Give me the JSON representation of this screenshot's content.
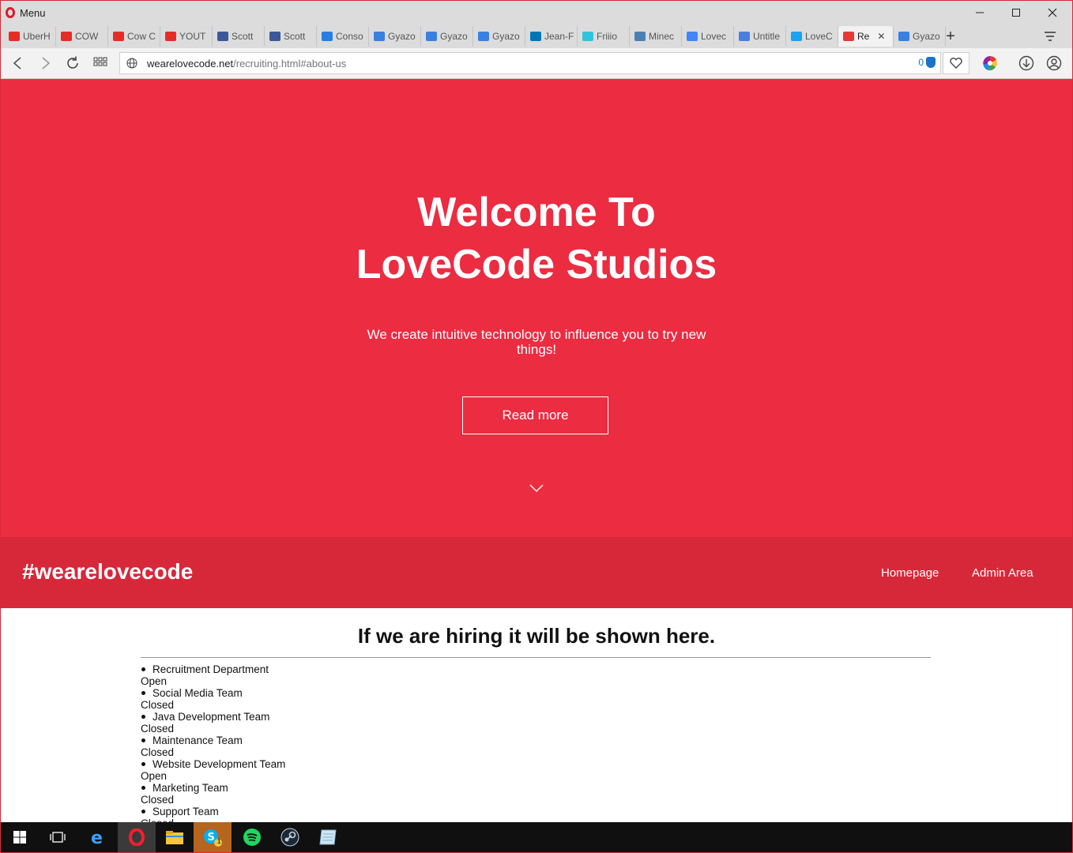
{
  "browser": {
    "menu_label": "Menu",
    "window_controls": {
      "minimize": "—",
      "maximize": "☐",
      "close": "✕"
    },
    "tabs": [
      {
        "label": "UberH",
        "icon": "youtube-icon",
        "color": "#e52d27"
      },
      {
        "label": "COW",
        "icon": "youtube-icon",
        "color": "#e52d27"
      },
      {
        "label": "Cow C",
        "icon": "youtube-icon",
        "color": "#e52d27"
      },
      {
        "label": "YOUT",
        "icon": "youtube-icon",
        "color": "#e52d27"
      },
      {
        "label": "Scott",
        "icon": "facebook-icon",
        "color": "#3b5998"
      },
      {
        "label": "Scott",
        "icon": "facebook-icon",
        "color": "#3b5998"
      },
      {
        "label": "Conso",
        "icon": "console-icon",
        "color": "#2a7de1"
      },
      {
        "label": "Gyazo",
        "icon": "gyazo-icon",
        "color": "#3b7fe0"
      },
      {
        "label": "Gyazo",
        "icon": "gyazo-icon",
        "color": "#3b7fe0"
      },
      {
        "label": "Gyazo",
        "icon": "gyazo-icon",
        "color": "#3b7fe0"
      },
      {
        "label": "Jean-F",
        "icon": "linkedin-icon",
        "color": "#0077b5"
      },
      {
        "label": "Friiio",
        "icon": "friiio-icon",
        "color": "#2ec4e0"
      },
      {
        "label": "Minec",
        "icon": "cube-icon",
        "color": "#4a7fb5"
      },
      {
        "label": "Lovec",
        "icon": "google-icon",
        "color": "#4285f4"
      },
      {
        "label": "Untitle",
        "icon": "docs-icon",
        "color": "#4a7fe0"
      },
      {
        "label": "LoveC",
        "icon": "twitter-icon",
        "color": "#1da1f2"
      },
      {
        "label": "Re",
        "icon": "lovecode-icon",
        "color": "#e53935",
        "active": true
      },
      {
        "label": "Gyazo",
        "icon": "gyazo-icon",
        "color": "#3b7fe0"
      }
    ],
    "new_tab": "+",
    "url": {
      "domain": "wearelovecode.net",
      "path": "/recruiting.html#about-us"
    },
    "adblock_count": "0"
  },
  "page": {
    "hero": {
      "title_line1": "Welcome To",
      "title_line2": "LoveCode Studios",
      "subtitle": "We create intuitive technology to influence you to try new things!",
      "button": "Read more"
    },
    "nav": {
      "brand": "#wearelovecode",
      "links": [
        "Homepage",
        "Admin Area"
      ]
    },
    "hiring": {
      "heading": "If we are hiring it will be shown here.",
      "teams": [
        {
          "name": "Recruitment Department",
          "status": "Open"
        },
        {
          "name": "Social Media Team",
          "status": "Closed"
        },
        {
          "name": "Java Development Team",
          "status": "Closed"
        },
        {
          "name": "Maintenance Team",
          "status": "Closed"
        },
        {
          "name": "Website Development Team",
          "status": "Open"
        },
        {
          "name": "Marketing Team",
          "status": "Closed"
        },
        {
          "name": "Support Team",
          "status": "Closed"
        }
      ]
    },
    "colors": {
      "hero": "#eb2c41",
      "nav": "#d72839"
    }
  },
  "taskbar": {
    "items": [
      "windows-start-icon",
      "task-view-icon",
      "edge-icon",
      "opera-icon",
      "file-explorer-icon",
      "skype-icon",
      "spotify-icon",
      "steam-icon",
      "notes-icon"
    ],
    "skype_badge": "1"
  }
}
